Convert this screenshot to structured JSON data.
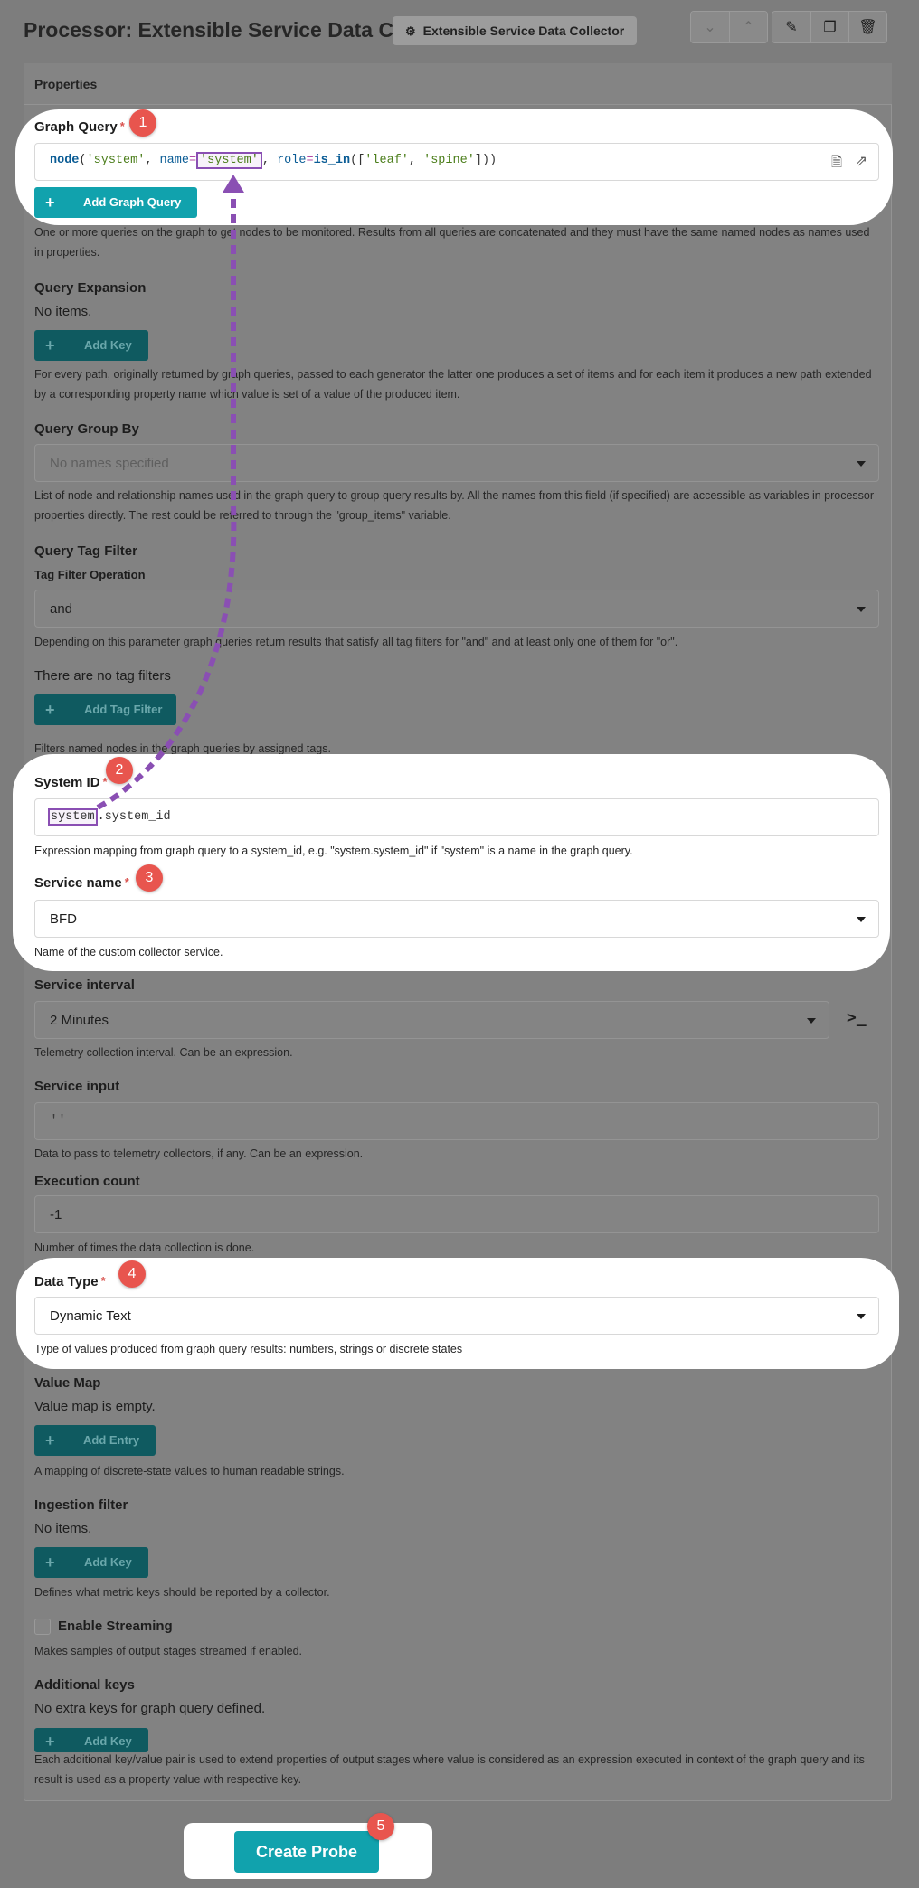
{
  "header": {
    "title": "Processor: Extensible Service Data Collector",
    "chip_label": "Extensible Service Data Collector",
    "chip_icon": "processor-icon",
    "nav_buttons": [
      "chevron-down-icon",
      "chevron-up-icon"
    ],
    "action_buttons": [
      "edit-icon",
      "copy-icon",
      "trash-icon"
    ]
  },
  "panel": {
    "title": "Properties"
  },
  "graph_query": {
    "label": "Graph Query",
    "required": "*",
    "badge": "1",
    "code": {
      "fn": "node",
      "open": "(",
      "arg1": "'system'",
      "sep1": ", ",
      "kw1": "name",
      "eq1": "=",
      "arg2": "'system'",
      "sep2": ", ",
      "kw2": "role",
      "eq2": "=",
      "fn2": "is_in",
      "open2": "([",
      "arg3": "'leaf'",
      "sep3": ", ",
      "arg4": "'spine'",
      "close": "]))"
    },
    "add_button": "Add Graph Query",
    "help": "One or more queries on the graph to get nodes to be monitored. Results from all queries are concatenated and they must have the same named nodes as names used in properties."
  },
  "query_expansion": {
    "label": "Query Expansion",
    "empty_text": "No items.",
    "add_button": "Add Key",
    "help": "For every path, originally returned by graph queries, passed to each generator the latter one produces a set of items and for each item it produces a new path extended by a corresponding property name which value is set of a value of the produced item."
  },
  "query_group_by": {
    "label": "Query Group By",
    "placeholder": "No names specified",
    "help": "List of node and relationship names used in the graph query to group query results by. All the names from this field (if specified) are accessible as variables in processor properties directly. The rest could be referred to through the \"group_items\" variable."
  },
  "query_tag_filter": {
    "label": "Query Tag Filter",
    "sub_label": "Tag Filter Operation",
    "value": "and",
    "help": "Depending on this parameter graph queries return results that satisfy all tag filters for \"and\" and at least only one of them for \"or\".",
    "empty_text": "There are no tag filters",
    "add_button": "Add Tag Filter",
    "help2": "Filters named nodes in the graph queries by assigned tags."
  },
  "system_id": {
    "label": "System ID",
    "required": "*",
    "badge": "2",
    "value_highlight": "system",
    "value_rest": ".system_id",
    "help": "Expression mapping from graph query to a system_id, e.g. \"system.system_id\" if \"system\" is a name in the graph query."
  },
  "service_name": {
    "label": "Service name",
    "required": "*",
    "badge": "3",
    "value": "BFD",
    "help": "Name of the custom collector service."
  },
  "service_interval": {
    "label": "Service interval",
    "value": "2 Minutes",
    "toggle_icon": "expression-icon",
    "help": "Telemetry collection interval. Can be an expression."
  },
  "service_input": {
    "label": "Service input",
    "value": "''",
    "help": "Data to pass to telemetry collectors, if any. Can be an expression."
  },
  "execution_count": {
    "label": "Execution count",
    "value": "-1",
    "help": "Number of times the data collection is done."
  },
  "data_type": {
    "label": "Data Type",
    "required": "*",
    "badge": "4",
    "value": "Dynamic Text",
    "help": "Type of values produced from graph query results: numbers, strings or discrete states"
  },
  "value_map": {
    "label": "Value Map",
    "empty_text": "Value map is empty.",
    "add_button": "Add Entry",
    "help": "A mapping of discrete-state values to human readable strings."
  },
  "ingestion_filter": {
    "label": "Ingestion filter",
    "empty_text": "No items.",
    "add_button": "Add Key",
    "help": "Defines what metric keys should be reported by a collector."
  },
  "streaming": {
    "label": "Enable Streaming",
    "help": "Makes samples of output stages streamed if enabled."
  },
  "additional_keys": {
    "label": "Additional keys",
    "empty_text": "No extra keys for graph query defined.",
    "add_button": "Add Key",
    "help": "Each additional key/value pair is used to extend properties of output stages where value is considered as an expression executed in context of the graph query and its result is used as a property value with respective key."
  },
  "footer": {
    "create_button": "Create Probe",
    "badge": "5"
  },
  "colors": {
    "accent": "#11a2ad",
    "badge": "#e8554e",
    "arrow": "#8a4fb3",
    "overlay": "#7d7d7d"
  }
}
